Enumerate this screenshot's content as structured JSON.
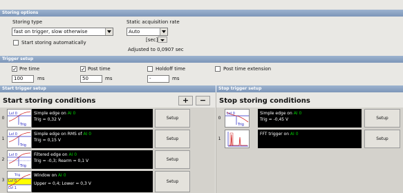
{
  "storing_options": {
    "header": "Storing options",
    "storing_type_label": "Storing type",
    "storing_type_value": "fast on trigger, slow otherwise",
    "start_auto_label": "Start storing automatically",
    "rate_label": "Static acquisition rate",
    "rate_value": "Auto",
    "unit_label": "[sec]",
    "adjusted_text": "Adjusted to 0,0907 sec"
  },
  "trigger_setup": {
    "header": "Trigger setup",
    "pre_time_label": "Pre time",
    "pre_time_value": "100",
    "pre_time_unit": "ms",
    "post_time_label": "Post time",
    "post_time_value": "50",
    "post_time_unit": "ms",
    "holdoff_label": "Holdoff time",
    "holdoff_value": "-",
    "holdoff_unit": "ms",
    "post_ext_label": "Post time extension",
    "pre_checked": true,
    "post_checked": true,
    "holdoff_checked": false,
    "post_ext_checked": false,
    "check_mark": "✓"
  },
  "start_trigger": {
    "header": "Start trigger setup",
    "title": "Start storing conditions",
    "add_label": "+",
    "remove_label": "−",
    "rows": [
      {
        "index": "0",
        "line1_pre": "Simple edge on ",
        "line1_ch": "AI 0",
        "line2": "Trig = 0,32 V",
        "setup": "Setup"
      },
      {
        "index": "1",
        "line1_pre": "Simple edge on  RMS of ",
        "line1_ch": "AI 0",
        "line2": "Trig = 0,15 V",
        "setup": "Setup"
      },
      {
        "index": "2",
        "line1_pre": "Filtered edge on ",
        "line1_ch": "AI 0",
        "line2": "Trig = -0,3; Rearm = 0,1 V",
        "setup": "Setup"
      },
      {
        "index": "3",
        "line1_pre": "Window on ",
        "line1_ch": "AI 0",
        "line2": "Upper = 0,4; Lower = 0,3 V",
        "setup": "Setup"
      }
    ]
  },
  "stop_trigger": {
    "header": "Stop trigger setup",
    "title": "Stop storing conditions",
    "rows": [
      {
        "index": "0",
        "line1_pre": "Simple edge on ",
        "line1_ch": "AI 0",
        "line2": "Trig = -0,45 V",
        "setup": "Setup"
      },
      {
        "index": "1",
        "line1_pre": "FFT trigger on ",
        "line1_ch": "AI 0",
        "line2": "",
        "setup": "Setup"
      }
    ]
  },
  "thumb_text": {
    "lvl0": "Lvl 0",
    "lvl1": "Lvl 1",
    "trig": "Trig"
  },
  "colors": {
    "header_bg": "#8aa2c2",
    "channel_green": "#00d000",
    "window_yellow": "#ffff00"
  }
}
